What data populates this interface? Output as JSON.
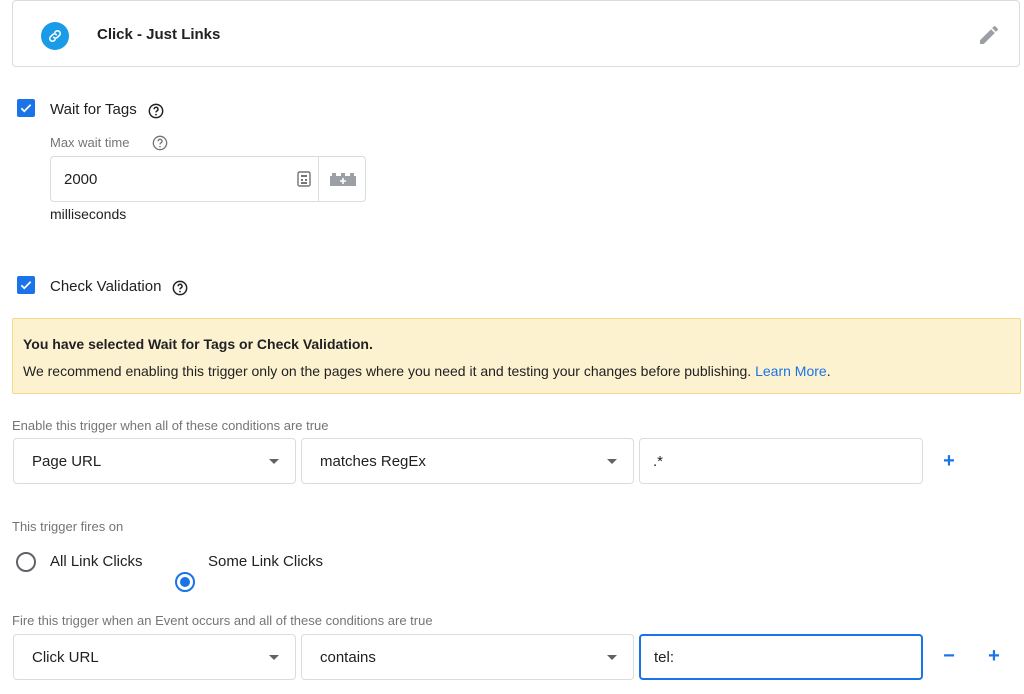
{
  "trigger_type": {
    "name": "Click - Just Links",
    "icon": "link-icon",
    "edit_icon": "pencil-icon"
  },
  "wait_for_tags": {
    "label": "Wait for Tags",
    "checked": true,
    "max_wait_label": "Max wait time",
    "max_wait_value": "2000",
    "unit": "milliseconds"
  },
  "check_validation": {
    "label": "Check Validation",
    "checked": true
  },
  "warning": {
    "title": "You have selected Wait for Tags or Check Validation.",
    "body": "We recommend enabling this trigger only on the pages where you need it and testing your changes before publishing.",
    "link": "Learn More"
  },
  "enable_conditions": {
    "label": "Enable this trigger when all of these conditions are true",
    "variable": "Page URL",
    "operator": "matches RegEx",
    "value": ".*",
    "add_label": "+"
  },
  "fires_on": {
    "label": "This trigger fires on",
    "options": [
      "All Link Clicks",
      "Some Link Clicks"
    ],
    "selected": "Some Link Clicks"
  },
  "fire_conditions": {
    "label": "Fire this trigger when an Event occurs and all of these conditions are true",
    "variable": "Click URL",
    "operator": "contains",
    "value": "tel:",
    "remove_label": "−",
    "add_label": "+"
  },
  "colors": {
    "accent": "#1a73e8",
    "link_badge": "#1a9be8",
    "warning_bg": "#fdf2cf"
  }
}
